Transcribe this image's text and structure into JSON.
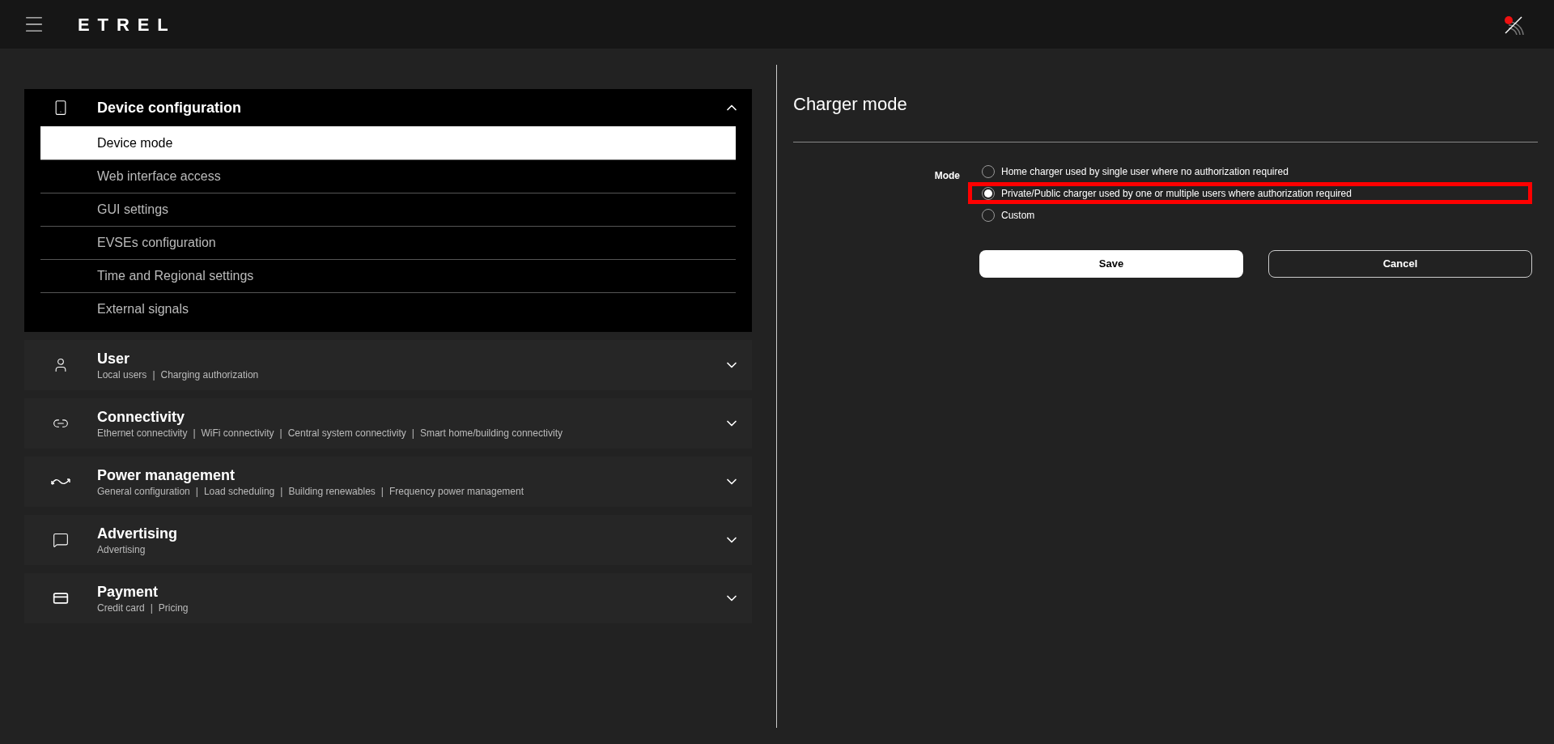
{
  "header": {
    "logo": "ETREL"
  },
  "sidebar": {
    "sections": [
      {
        "kind": "device",
        "title": "Device configuration",
        "expanded": true,
        "items": [
          {
            "label": "Device mode",
            "selected": true
          },
          {
            "label": "Web interface access",
            "selected": false
          },
          {
            "label": "GUI settings",
            "selected": false
          },
          {
            "label": "EVSEs configuration",
            "selected": false
          },
          {
            "label": "Time and Regional settings",
            "selected": false
          },
          {
            "label": "External signals",
            "selected": false
          }
        ]
      },
      {
        "kind": "user",
        "title": "User",
        "expanded": false,
        "links": [
          {
            "text": "Local users"
          },
          {
            "separator": "|",
            "text": "Charging authorization"
          }
        ]
      },
      {
        "kind": "connectivity",
        "title": "Connectivity",
        "expanded": false,
        "links": [
          {
            "text": "Ethernet connectivity"
          },
          {
            "separator": "|",
            "text": "WiFi connectivity"
          },
          {
            "separator": "|",
            "text": "Central system connectivity"
          },
          {
            "separator": "|",
            "text": "Smart home/building connectivity"
          }
        ]
      },
      {
        "kind": "power",
        "title": "Power management",
        "expanded": false,
        "links": [
          {
            "text": "General configuration"
          },
          {
            "separator": "|",
            "text": "Load scheduling"
          },
          {
            "separator": "|",
            "text": "Building renewables"
          },
          {
            "separator": "|",
            "text": "Frequency power management"
          }
        ]
      },
      {
        "kind": "advertising",
        "title": "Advertising",
        "expanded": false,
        "links": [
          {
            "text": "Advertising"
          }
        ]
      },
      {
        "kind": "payment",
        "title": "Payment",
        "expanded": false,
        "links": [
          {
            "text": "Credit card"
          },
          {
            "separator": "|",
            "text": "Pricing"
          }
        ]
      }
    ]
  },
  "form": {
    "title": "Charger mode",
    "field_label": "Mode",
    "options": [
      {
        "label": "Home charger used by single user where no authorization required",
        "selected": false,
        "highlighted": false
      },
      {
        "label": "Private/Public charger used by one or multiple users where authorization required",
        "selected": true,
        "highlighted": true
      },
      {
        "label": "Custom",
        "selected": false,
        "highlighted": false
      }
    ],
    "buttons": [
      {
        "kind": "primary",
        "label": "Save"
      },
      {
        "kind": "secondary",
        "label": "Cancel"
      }
    ]
  }
}
